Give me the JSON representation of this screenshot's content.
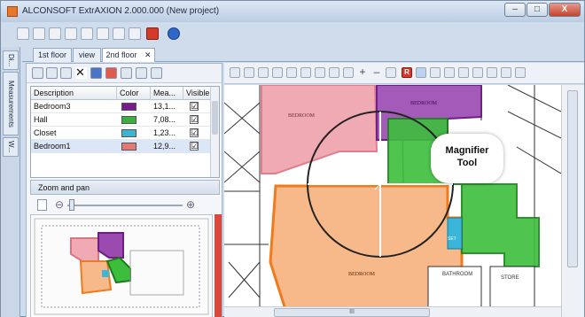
{
  "window": {
    "title": "ALCONSOFT ExtrAXION 2.000.000 (New project)",
    "min": "–",
    "max": "□",
    "close": "X"
  },
  "sidebar": {
    "tabs": [
      "Di...",
      "Measurements",
      "W..."
    ]
  },
  "doc_tabs": [
    {
      "label": "1st floor"
    },
    {
      "label": "view"
    },
    {
      "label": "2nd floor"
    }
  ],
  "doc_tab_close": "✕",
  "table": {
    "headers": [
      "Description",
      "Color",
      "Mea...",
      "Visible"
    ],
    "rows": [
      {
        "description": "Bedroom3",
        "color": "#7a1a8c",
        "measure": "13,1...",
        "visible": "☑"
      },
      {
        "description": "Hall",
        "color": "#3cae3c",
        "measure": "7,08...",
        "visible": "☑"
      },
      {
        "description": "Closet",
        "color": "#3fb3d6",
        "measure": "1,23...",
        "visible": "☑"
      },
      {
        "description": "Bedroom1",
        "color": "#e77676",
        "measure": "12,9...",
        "visible": "☑"
      }
    ]
  },
  "zoom_panel": {
    "title": "Zoom and pan",
    "minus": "⊖",
    "plus": "⊕"
  },
  "map_toolbar_letters": {
    "r": "R",
    "plus": "+",
    "minus": "–"
  },
  "plan": {
    "bedroom_label": "BEDROOM",
    "bathroom_label": "BATHROOM",
    "store_label": "STORE",
    "set_label": "SET"
  },
  "callout": {
    "line1": "Magnifier",
    "line2": "Tool"
  },
  "hscroll": {
    "grip": "III"
  },
  "colors": {
    "pink": "#f0aab4",
    "purple": "#8c3a9e",
    "green": "#3cbe3c",
    "orange": "#f7b98a",
    "orange_line": "#ee7b1e",
    "cyan": "#39b6d9"
  }
}
